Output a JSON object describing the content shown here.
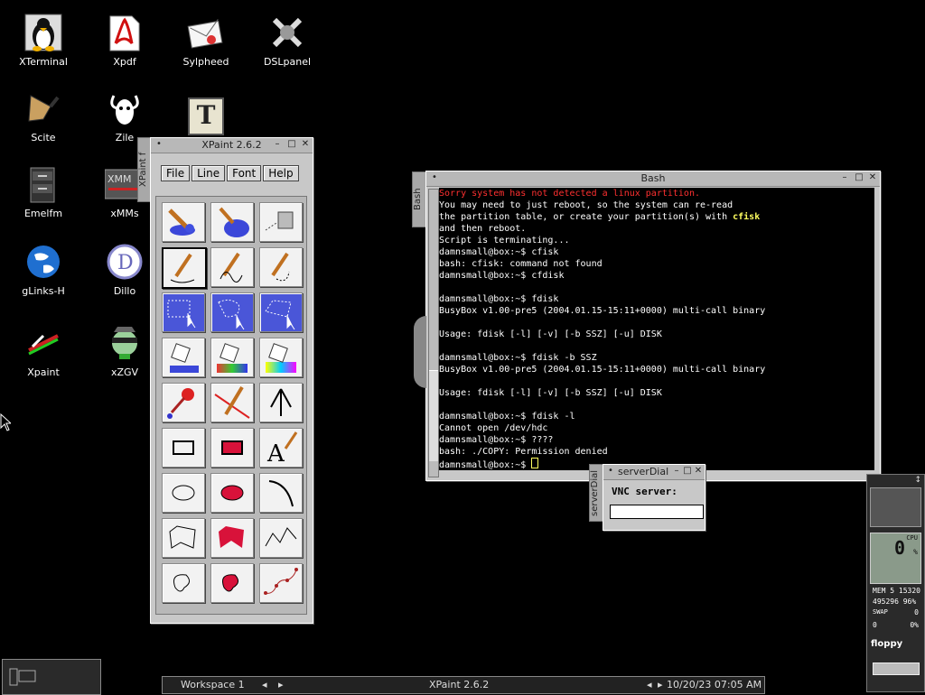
{
  "desktop": {
    "icons": [
      {
        "label": "XTerminal",
        "icon": "tux-penguin-icon"
      },
      {
        "label": "Xpdf",
        "icon": "pdf-icon"
      },
      {
        "label": "Sylpheed",
        "icon": "mail-icon"
      },
      {
        "label": "DSLpanel",
        "icon": "tools-icon"
      },
      {
        "label": "Scite",
        "icon": "pen-nib-icon"
      },
      {
        "label": "Zile",
        "icon": "gnu-icon"
      },
      {
        "label": "Emelfm",
        "icon": "file-cabinet-icon"
      },
      {
        "label": "xMMs",
        "icon": "media-player-icon"
      },
      {
        "label": "gLinks-H",
        "icon": "globe-icon"
      },
      {
        "label": "Dillo",
        "icon": "dillo-icon"
      },
      {
        "label": "Xpaint",
        "icon": "paint-icon"
      },
      {
        "label": "xZGV",
        "icon": "image-viewer-icon"
      }
    ],
    "t_icon_letter": "T"
  },
  "xpaint": {
    "title": "XPaint 2.6.2",
    "sidetab": "XPaint f",
    "menu": [
      "File",
      "Line",
      "Font",
      "Help"
    ]
  },
  "bash": {
    "title": "Bash",
    "sidetab": "Bash",
    "lines": [
      {
        "t": "Sorry system has not detected a linux partition.",
        "c": "red"
      },
      {
        "t": "You may need to just reboot, so the system can re-read",
        "c": ""
      },
      {
        "t": "the partition table, or create your partition(s) with ",
        "c": "",
        "tail": "cfisk"
      },
      {
        "t": "and then reboot.",
        "c": ""
      },
      {
        "t": "Script is terminating...",
        "c": ""
      },
      {
        "t": "damnsmall@box:~$ cfisk",
        "c": ""
      },
      {
        "t": "bash: cfisk: command not found",
        "c": ""
      },
      {
        "t": "damnsmall@box:~$ cfdisk",
        "c": ""
      },
      {
        "t": "",
        "c": ""
      },
      {
        "t": "damnsmall@box:~$ fdisk",
        "c": ""
      },
      {
        "t": "BusyBox v1.00-pre5 (2004.01.15-15:11+0000) multi-call binary",
        "c": ""
      },
      {
        "t": "",
        "c": ""
      },
      {
        "t": "Usage: fdisk [-l] [-v] [-b SSZ] [-u] DISK",
        "c": ""
      },
      {
        "t": "",
        "c": ""
      },
      {
        "t": "damnsmall@box:~$ fdisk -b SSZ",
        "c": ""
      },
      {
        "t": "BusyBox v1.00-pre5 (2004.01.15-15:11+0000) multi-call binary",
        "c": ""
      },
      {
        "t": "",
        "c": ""
      },
      {
        "t": "Usage: fdisk [-l] [-v] [-b SSZ] [-u] DISK",
        "c": ""
      },
      {
        "t": "",
        "c": ""
      },
      {
        "t": "damnsmall@box:~$ fdisk -l",
        "c": ""
      },
      {
        "t": "Cannot open /dev/hdc",
        "c": ""
      },
      {
        "t": "damnsmall@box:~$ ????",
        "c": ""
      },
      {
        "t": "bash: ./COPY: Permission denied",
        "c": ""
      },
      {
        "t": "damnsmall@box:~$ ",
        "c": "",
        "cursor": true
      }
    ]
  },
  "server_dial": {
    "title": "serverDial",
    "sidetab": "serverDial",
    "label": "VNC server:",
    "value": ""
  },
  "taskbar": {
    "workspace": "Workspace 1",
    "active": "XPaint 2.6.2",
    "clock": "10/20/23 07:05 AM"
  },
  "monitor": {
    "cpu_label": "CPU",
    "cpu_value": "0",
    "cpu_unit": "%",
    "mem_line": "MEM 5 15320",
    "mem_line2": "495296 96%",
    "swap_label": "SWAP",
    "swap_value": "0",
    "swap_line2_left": "0",
    "swap_line2_right": "0%",
    "floppy": "floppy"
  }
}
